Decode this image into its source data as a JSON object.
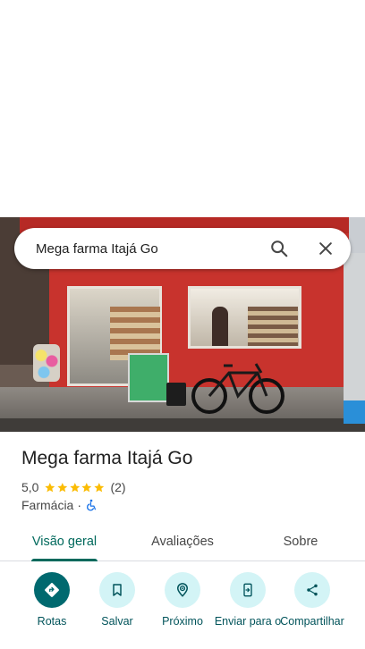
{
  "search": {
    "query": "Mega farma Itajá Go"
  },
  "place": {
    "name": "Mega farma Itajá Go",
    "rating": "5,0",
    "stars": 5,
    "review_count": "(2)",
    "category": "Farmácia",
    "separator": "·",
    "accessibility_icon": "wheelchair-icon"
  },
  "tabs": [
    {
      "label": "Visão geral",
      "active": true
    },
    {
      "label": "Avaliações",
      "active": false
    },
    {
      "label": "Sobre",
      "active": false
    }
  ],
  "actions": [
    {
      "label": "Rotas",
      "icon": "directions-icon"
    },
    {
      "label": "Salvar",
      "icon": "bookmark-icon"
    },
    {
      "label": "Próximo",
      "icon": "nearby-icon"
    },
    {
      "label": "Enviar para o",
      "icon": "send-to-phone-icon"
    },
    {
      "label": "Compartilhar",
      "icon": "share-icon"
    }
  ],
  "colors": {
    "accent": "#00696f",
    "tab_active": "#00695c",
    "star": "#fbbc04",
    "action_bg": "#d3f4f6"
  }
}
